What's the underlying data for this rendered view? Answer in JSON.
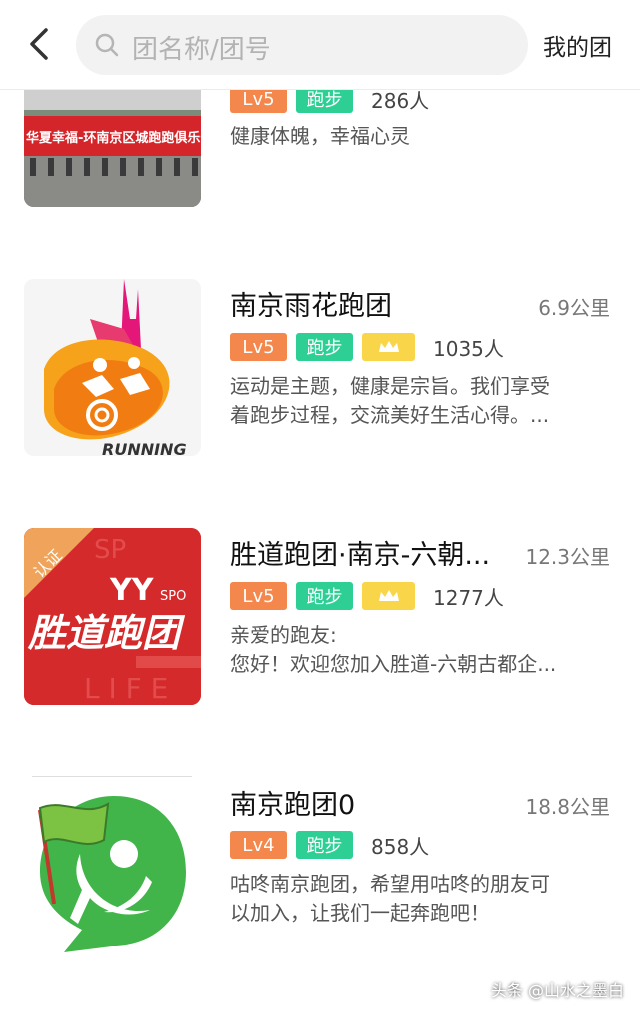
{
  "header": {
    "search_placeholder": "团名称/团号",
    "my_team_label": "我的团"
  },
  "groups": [
    {
      "level": "Lv5",
      "type": "跑步",
      "members": "286人",
      "desc": [
        "健康体魄，幸福心灵"
      ],
      "banner_text": "华夏幸福-环南京区城跑跑俱乐部"
    },
    {
      "name": "南京雨花跑团",
      "distance": "6.9公里",
      "level": "Lv5",
      "type": "跑步",
      "crown": true,
      "members": "1035人",
      "desc": [
        "运动是主题，健康是宗旨。我们享受",
        "着跑步过程，交流美好生活心得。..."
      ],
      "logo_caption": "RUNNING"
    },
    {
      "name": "胜道跑团·南京-六朝...",
      "distance": "12.3公里",
      "level": "Lv5",
      "type": "跑步",
      "crown": true,
      "members": "1277人",
      "desc": [
        "亲爱的跑友:",
        "您好！欢迎您加入胜道-六朝古都企..."
      ],
      "certified": "认证",
      "logo_text": "胜道跑团",
      "logo_yy": "YY",
      "logo_sport": "SPO"
    },
    {
      "name": "南京跑团0",
      "distance": "18.8公里",
      "level": "Lv4",
      "type": "跑步",
      "members": "858人",
      "desc": [
        "咕咚南京跑团，希望用咕咚的朋友可",
        "以加入，让我们一起奔跑吧！"
      ]
    }
  ],
  "watermark": "头条 @山水之墨白",
  "colors": {
    "level": "#f4874b",
    "type": "#2ecf95",
    "crown": "#f9d649"
  }
}
